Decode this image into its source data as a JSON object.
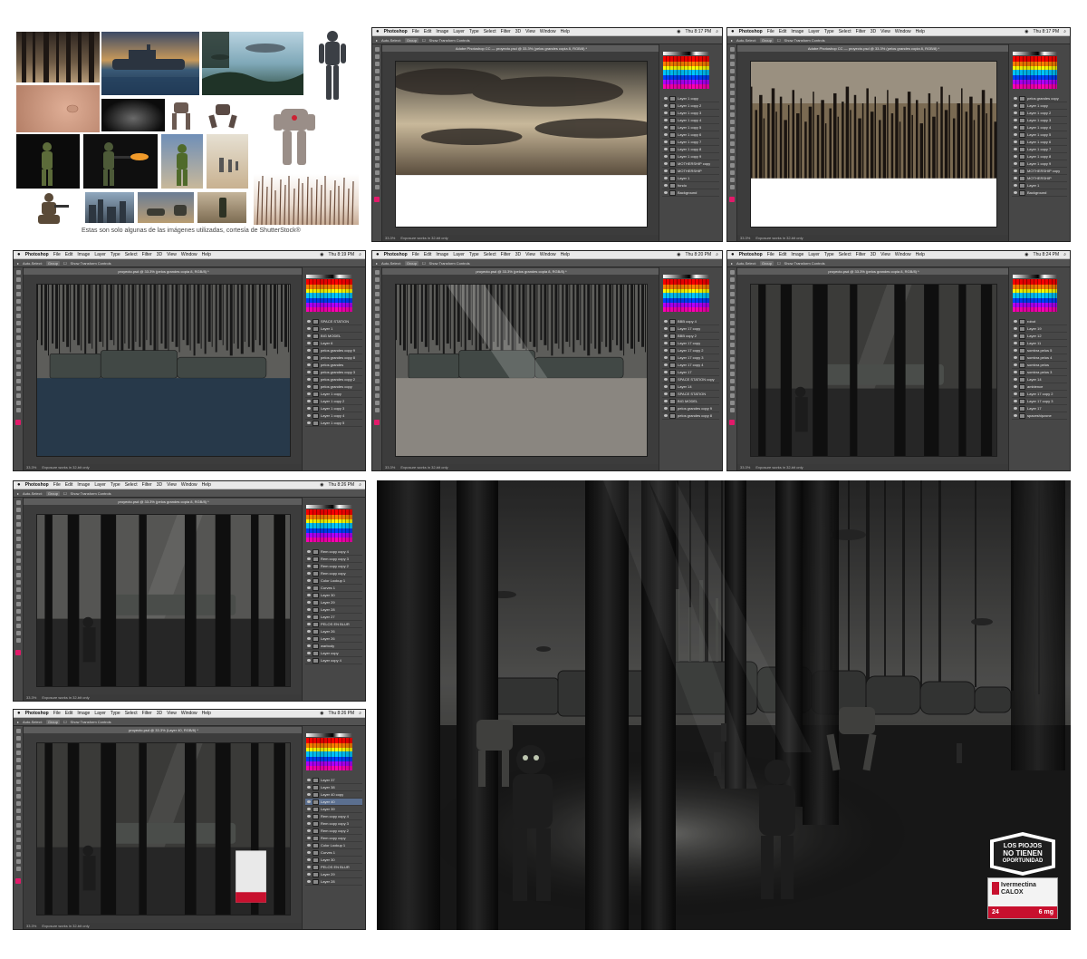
{
  "reference": {
    "caption": "Estas son solo algunas de las imágenes utilizadas, cortesía de ShutterStock®"
  },
  "photoshop": {
    "menu": [
      "Photoshop",
      "File",
      "Edit",
      "Image",
      "Layer",
      "Type",
      "Select",
      "Filter",
      "3D",
      "View",
      "Window",
      "Help"
    ],
    "status_text": "Exposure works in 32-bit only",
    "zoom": "33.3%",
    "window_title": "Adobe Photoshop CC",
    "screens": [
      {
        "time": "Thu 8:17 PM",
        "doc": "proyecto.psd @ 33.3% (pelos grandes copia 8, RGB/8) *",
        "layers": [
          "Layer 1 copy",
          "Layer 1 copy 2",
          "Layer 1 copy 3",
          "Layer 1 copy 4",
          "Layer 1 copy 5",
          "Layer 1 copy 6",
          "Layer 1 copy 7",
          "Layer 1 copy 8",
          "Layer 1 copy 9",
          "MOTHERSHIP copy",
          "MOTHERSHIP",
          "Layer 1",
          "fondo",
          "Background"
        ]
      },
      {
        "time": "Thu 8:17 PM",
        "doc": "proyecto.psd @ 33.3% (pelos grandes copia 8, RGB/8) *",
        "layers": [
          "pelos grandes copy",
          "Layer 1 copy",
          "Layer 1 copy 2",
          "Layer 1 copy 3",
          "Layer 1 copy 4",
          "Layer 1 copy 5",
          "Layer 1 copy 6",
          "Layer 1 copy 7",
          "Layer 1 copy 8",
          "Layer 1 copy 9",
          "MOTHERSHIP copy",
          "MOTHERSHIP",
          "Layer 1",
          "Background"
        ]
      },
      {
        "time": "Thu 8:19 PM",
        "doc": "proyecto.psd @ 33.3% (pelos grandes copia 8, RGB/8) *",
        "layers": [
          "SPACE STATION",
          "Layer 1",
          "BIG MODEL",
          "Layer 6",
          "pelos grandes copy 9",
          "pelos grandes copy 8",
          "pelos grandes",
          "pelos grandes copy 3",
          "pelos grandes copy 2",
          "pelos grandes copy",
          "Layer 1 copy",
          "Layer 1 copy 2",
          "Layer 1 copy 3",
          "Layer 1 copy 4",
          "Layer 1 copy 5"
        ]
      },
      {
        "time": "Thu 8:20 PM",
        "doc": "proyecto.psd @ 33.3% (pelos grandes copia 8, RGB/8) *",
        "layers": [
          "BBB copy 4",
          "Layer 17 copy",
          "BBB copy 2",
          "Layer 17 copy",
          "Layer 17 copy 2",
          "Layer 17 copy 3",
          "Layer 17 copy 4",
          "Layer 17",
          "SPACE STATION copy",
          "Layer 14",
          "SPACE STATION",
          "BIG MODEL",
          "pelos grandes copy 9",
          "pelos grandes copy 8"
        ]
      },
      {
        "time": "Thu 8:24 PM",
        "doc": "proyecto.psd @ 33.3% (pelos grandes copia 8, RGB/8) *",
        "layers": [
          "robot",
          "Layer 19",
          "Layer 12",
          "Layer 11",
          "sombra pelos 5",
          "sombra pelos 4",
          "sombra pelos",
          "sombra pelos 3",
          "Layer 14",
          "ambience",
          "Layer 17 copy 2",
          "Layer 17 copy 3",
          "Layer 17",
          "spaceshipzone"
        ]
      },
      {
        "time": "Thu 8:26 PM",
        "doc": "proyecto.psd @ 33.3% (pelos grandes copia 8, RGB/8) *",
        "layers": [
          "Rem copy copy 4",
          "Rem copy copy 3",
          "Rem copy copy 2",
          "Rem copy copy",
          "Color Lookup 1",
          "Curves 1",
          "Layer 30",
          "Layer 29",
          "Layer 28",
          "Layer 27",
          "PELOS EN BLUR",
          "Layer 26",
          "Layer 26",
          "warbody",
          "Layer copy",
          "Layer copy 4"
        ]
      },
      {
        "time": "Thu 8:26 PM",
        "doc": "proyecto.psd @ 33.3% (Layer 40, RGB/8) *",
        "layers": [
          "Layer 37",
          "Layer 38",
          "Layer 40 copy",
          "Layer 40",
          "Layer 39",
          "Rem copy copy 4",
          "Rem copy copy 3",
          "Rem copy copy 2",
          "Rem copy copy",
          "Color Lookup 1",
          "Curves 1",
          "Layer 30",
          "PELOS EN BLUR",
          "Layer 29",
          "Layer 28"
        ]
      }
    ]
  },
  "final": {
    "badge_lines": [
      "LOS PIOJOS",
      "NO TIENEN",
      "OPORTUNIDAD"
    ],
    "product_name": "Ivermectina",
    "product_sub": "CALOX",
    "count": "24",
    "dose": "6 mg"
  }
}
